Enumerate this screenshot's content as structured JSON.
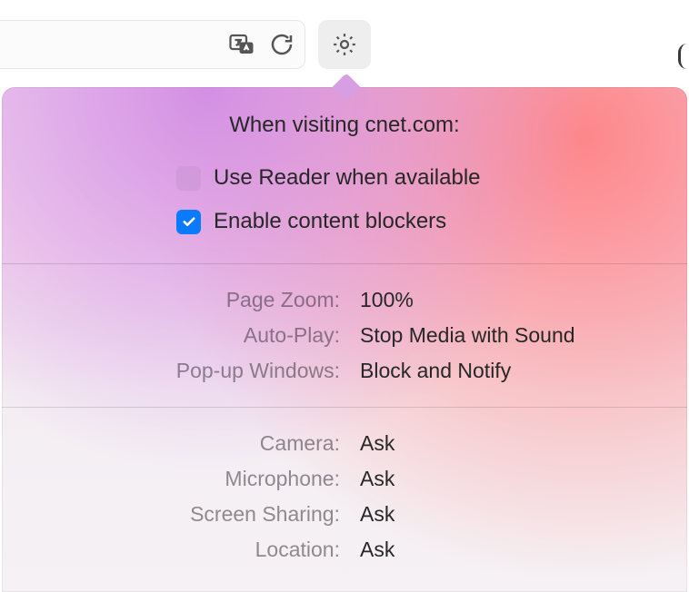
{
  "toolbar": {
    "translate_icon": "translate-icon",
    "reload_icon": "reload-icon",
    "settings_icon": "gear-icon"
  },
  "popover": {
    "title": "When visiting cnet.com:",
    "options": {
      "reader": {
        "label": "Use Reader when available",
        "checked": false
      },
      "blockers": {
        "label": "Enable content blockers",
        "checked": true
      }
    },
    "display": {
      "page_zoom": {
        "label": "Page Zoom:",
        "value": "100%"
      },
      "auto_play": {
        "label": "Auto-Play:",
        "value": "Stop Media with Sound"
      },
      "popups": {
        "label": "Pop-up Windows:",
        "value": "Block and Notify"
      }
    },
    "permissions": {
      "camera": {
        "label": "Camera:",
        "value": "Ask"
      },
      "mic": {
        "label": "Microphone:",
        "value": "Ask"
      },
      "screen": {
        "label": "Screen Sharing:",
        "value": "Ask"
      },
      "location": {
        "label": "Location:",
        "value": "Ask"
      }
    }
  }
}
